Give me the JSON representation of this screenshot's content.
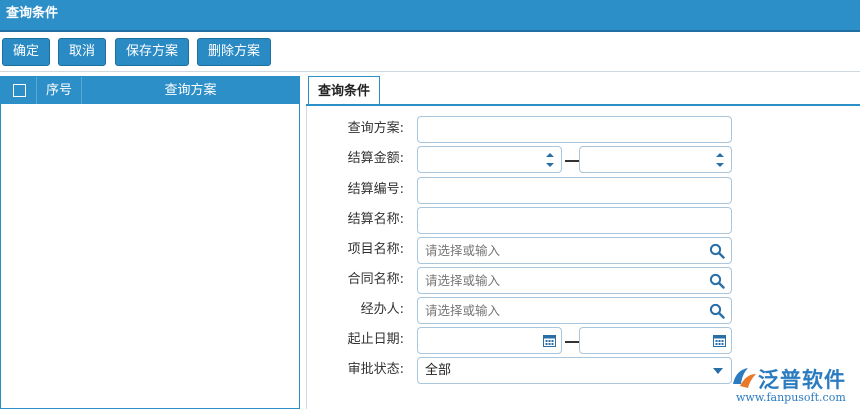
{
  "window": {
    "title": "查询条件"
  },
  "toolbar": {
    "buttons": [
      {
        "label": "确定"
      },
      {
        "label": "取消"
      },
      {
        "label": "保存方案"
      },
      {
        "label": "删除方案"
      }
    ]
  },
  "grid": {
    "columns": [
      "序号",
      "查询方案"
    ]
  },
  "tab": {
    "label": "查询条件"
  },
  "form": {
    "scheme_label": "查询方案:",
    "amount_label": "结算金额:",
    "code_label": "结算编号:",
    "name_label": "结算名称:",
    "project_label": "项目名称:",
    "project_placeholder": "请选择或输入",
    "contract_label": "合同名称:",
    "contract_placeholder": "请选择或输入",
    "handler_label": "经办人:",
    "handler_placeholder": "请选择或输入",
    "date_label": "起止日期:",
    "status_label": "审批状态:",
    "status_value": "全部"
  },
  "logo": {
    "text": "泛普软件",
    "url": "www.fanpusoft.com"
  },
  "colors": {
    "primary": "#2d8fc8",
    "border": "#a9c6dc",
    "icon": "#2a6ea8"
  }
}
